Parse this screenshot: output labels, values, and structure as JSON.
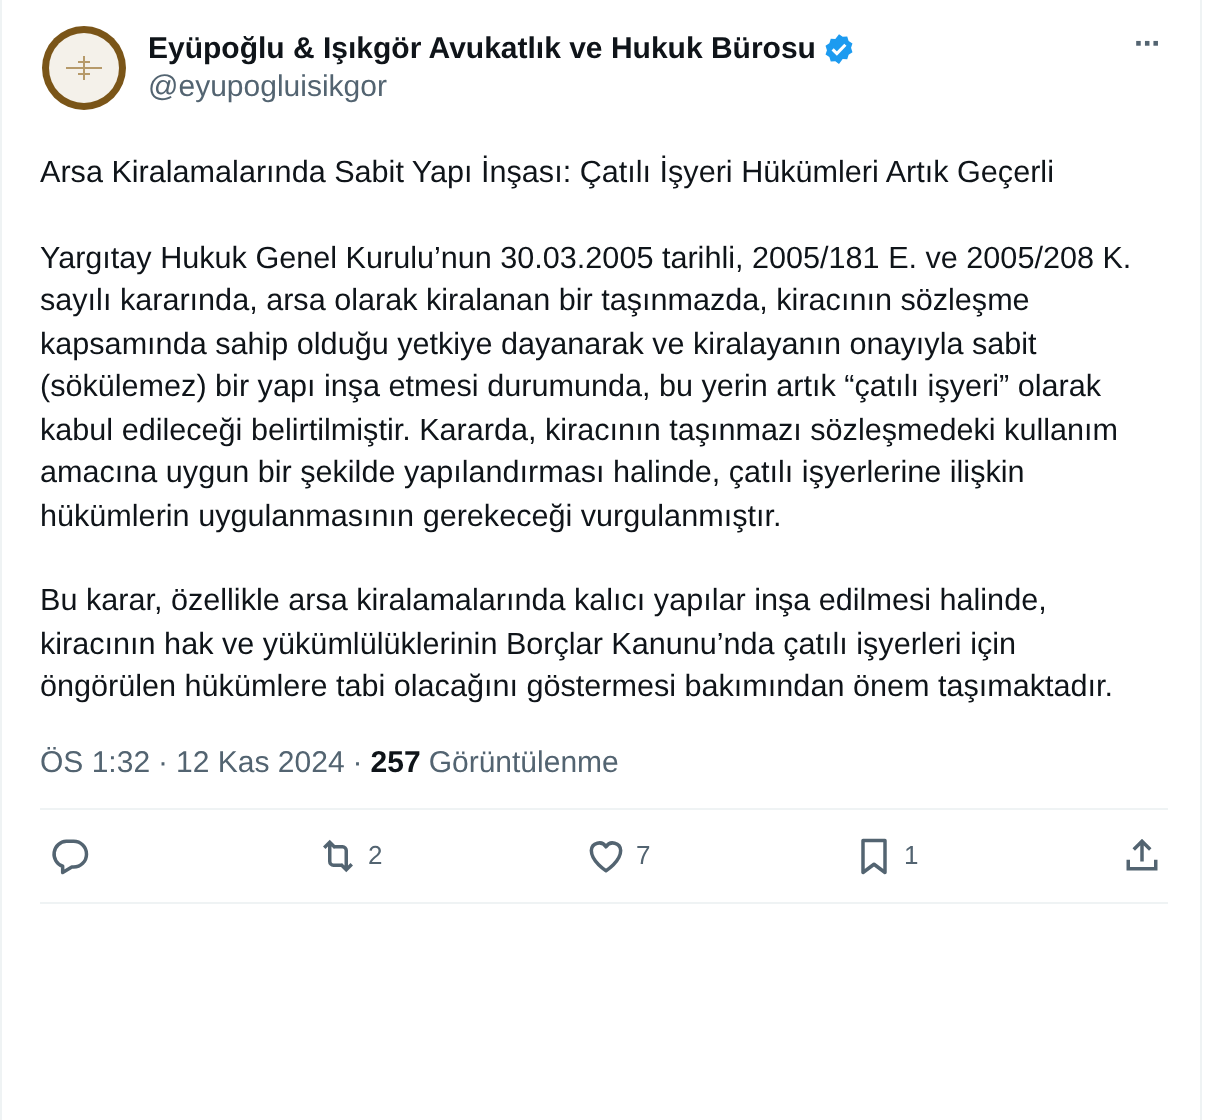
{
  "author": {
    "name": "Eyüpoğlu & Işıkgör Avukatlık ve Hukuk Bürosu",
    "verified": true,
    "handle": "@eyupogluisikgor"
  },
  "more_button": "···",
  "paragraphs": [
    "Arsa Kiralamalarında Sabit Yapı İnşası: Çatılı İşyeri Hükümleri Artık Geçerli",
    "Yargıtay Hukuk Genel Kurulu’nun 30.03.2005 tarihli, 2005/181 E. ve 2005/208 K. sayılı kararında, arsa olarak kiralanan bir taşınmazda, kiracının sözleşme kapsamında sahip olduğu yetkiye dayanarak ve kiralayanın onayıyla sabit (sökülemez) bir yapı inşa etmesi durumunda, bu yerin artık “çatılı işyeri” olarak kabul edileceği belirtilmiştir. Kararda, kiracının taşınmazı sözleşmedeki kullanım amacına uygun bir şekilde yapılandırması halinde, çatılı işyerlerine ilişkin hükümlerin uygulanmasının gerekeceği vurgulanmıştır.",
    "Bu karar, özellikle arsa kiralamalarında kalıcı yapılar inşa edilmesi halinde, kiracının hak ve yükümlülüklerinin Borçlar Kanunu’nda çatılı işyerleri için öngörülen hükümlere tabi olacağını göstermesi bakımından önem taşımaktadır."
  ],
  "meta": {
    "time": "ÖS 1:32",
    "separator": "·",
    "date": "12 Kas 2024",
    "views_count": "257",
    "views_label": "Görüntülenme"
  },
  "actions": [
    {
      "kind": "reply"
    },
    {
      "kind": "repost",
      "count": "2"
    },
    {
      "kind": "like",
      "count": "7"
    },
    {
      "kind": "bookmark",
      "count": "1"
    },
    {
      "kind": "share"
    }
  ]
}
